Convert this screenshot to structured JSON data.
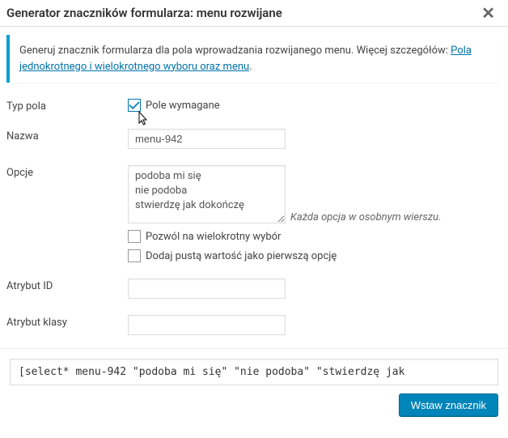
{
  "title": "Generator znaczników formularza: menu rozwijane",
  "info": {
    "text_before": "Generuj znacznik formularza dla pola wprowadzania rozwijanego menu. Więcej szczegółów: ",
    "link_text": "Pola jednokrotnego i wielokrotnego wyboru oraz menu",
    "text_after": "."
  },
  "labels": {
    "field_type": "Typ pola",
    "required": "Pole wymagane",
    "name": "Nazwa",
    "options": "Opcje",
    "hint": "Każda opcja w osobnym wierszu.",
    "allow_multiple": "Pozwól na wielokrotny wybór",
    "blank_first": "Dodaj pustą wartość jako pierwszą opcję",
    "id_attr": "Atrybut ID",
    "class_attr": "Atrybut klasy"
  },
  "values": {
    "required_checked": true,
    "name": "menu-942",
    "options_text": "podoba mi się\nnie podoba\nstwierdzę jak dokończę",
    "allow_multiple_checked": false,
    "blank_first_checked": false,
    "id_attr": "",
    "class_attr": ""
  },
  "shortcode": "[select* menu-942 \"podoba mi się\" \"nie podoba\" \"stwierdzę jak ",
  "insert_button": "Wstaw znacznik",
  "cursor_glyph": "↖"
}
